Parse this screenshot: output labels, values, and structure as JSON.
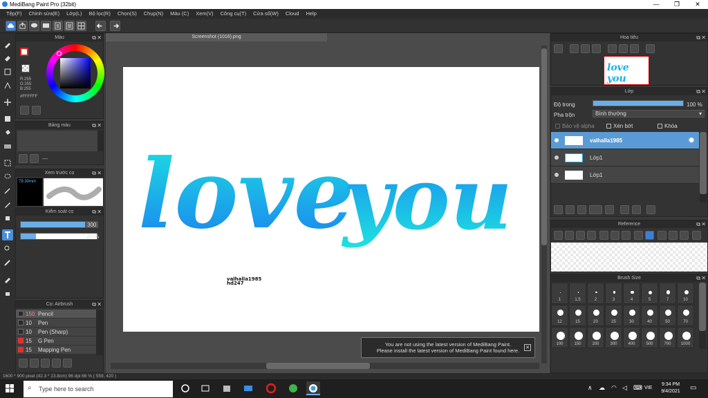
{
  "window": {
    "title": "MediBang Paint Pro (32bit)",
    "min": "—",
    "max": "❐",
    "close": "✕"
  },
  "menu": [
    "Tệp(F)",
    "Chỉnh sửa(E)",
    "Lớp(L)",
    "Bộ lọc(R)",
    "Chọn(S)",
    "Chụp(N)",
    "Màu (C)",
    "Xem(V)",
    "Công cụ(T)",
    "Cửa sổ(W)",
    "Cloud",
    "Help"
  ],
  "color_panel": {
    "title": "Màu",
    "rgb": [
      "R:255",
      "G:255",
      "B:255"
    ],
    "hex": "#FFFFFF"
  },
  "palette_panel": {
    "title": "Bảng màu",
    "dash": "---"
  },
  "brush_preview_panel": {
    "title": "Xem trước cọ",
    "size": "79.30mm"
  },
  "brush_control_panel": {
    "title": "Kiểm soát cọ",
    "size_value": "300",
    "opacity_value": "20 %",
    "size_fill": 1.0,
    "opacity_fill": 0.2
  },
  "brush_list_panel": {
    "title": "Cọ: Airbrush",
    "items": [
      {
        "size": "150",
        "name": "Pencil",
        "color": "#2a2a2a"
      },
      {
        "size": "10",
        "name": "Pen",
        "color": "#2a2a2a"
      },
      {
        "size": "10",
        "name": "Pen (Sharp)",
        "color": "#2a2a2a"
      },
      {
        "size": "15",
        "name": "G Pen",
        "color": "#e03030"
      },
      {
        "size": "15",
        "name": "Mapping Pen",
        "color": "#e03030"
      }
    ]
  },
  "canvas": {
    "tab": "Screenshot (1016).png",
    "art_text_1": "love",
    "art_text_2": "you",
    "signature_1": "valhalla1985",
    "signature_2": "hd247"
  },
  "navigator_panel": {
    "title": "Hoa tiêu",
    "thumb_text": "love you"
  },
  "layer_panel": {
    "title": "Lớp",
    "opacity_label": "Độ trong",
    "opacity_value": "100 %",
    "opacity_fill": 1.0,
    "blend_label": "Pha trộn",
    "blend_value": "Bình thường",
    "protect_alpha": "Bảo vệ alpha",
    "clipping": "Xén bớt",
    "lock": "Khóa",
    "layers": [
      {
        "name": "valhalla1985",
        "selected": true
      },
      {
        "name": "Lớp1",
        "selected": false
      },
      {
        "name": "Lớp1",
        "selected": false
      }
    ]
  },
  "reference_panel": {
    "title": "Reference"
  },
  "brush_size_panel": {
    "title": "Brush Size",
    "row1": [
      "1",
      "1.5",
      "2",
      "3",
      "4",
      "5",
      "7",
      "10"
    ],
    "row2": [
      "12",
      "15",
      "20",
      "25",
      "30",
      "40",
      "50",
      "70"
    ],
    "row3": [
      "100",
      "150",
      "200",
      "300",
      "400",
      "500",
      "700",
      "1000"
    ]
  },
  "notice": {
    "line1": "You are not using the latest version of MediBang Paint.",
    "line2": "Please install the latest version of MediBang Paint found here."
  },
  "status": "1600 * 900 pixel  (42.3 * 23.8cm)  96 dpi  66 %  ( 559, 420 )",
  "taskbar": {
    "search_placeholder": "Type here to search",
    "lang": "VIE",
    "time": "9:34 PM",
    "date": "9/4/2021"
  },
  "colors": {
    "accent": "#4a90d9",
    "text_gradient_top": "#1de3e0",
    "text_gradient_bottom": "#1a7ff0"
  }
}
